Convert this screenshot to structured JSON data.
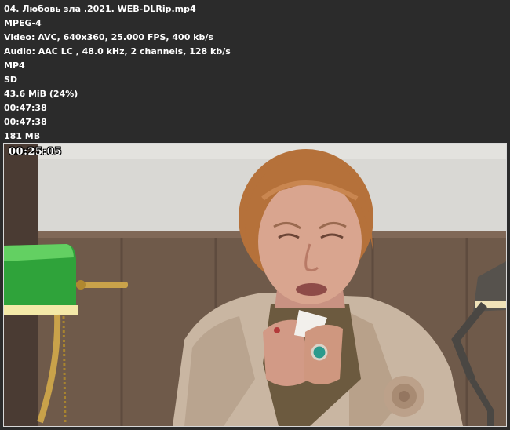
{
  "media_info": {
    "lines": [
      "04. Любовь зла .2021. WEB-DLRip.mp4",
      "MPEG-4",
      "Video: AVC, 640x360, 25.000 FPS, 400 kb/s",
      "Audio: AAC LC , 48.0 kHz, 2 channels, 128 kb/s",
      "MP4",
      "SD",
      "43.6 MiB (24%)",
      "00:47:38",
      "00:47:38",
      "181 MB"
    ]
  },
  "thumbnail": {
    "timestamp": "00:25:05",
    "colors": {
      "wall_upper": "#d9d8d4",
      "wall_panel": "#6f5a4a",
      "lamp_shade": "#2fa33a",
      "lamp_brass": "#c9a24a",
      "hair": "#b5713a",
      "skin": "#d9a58f",
      "jacket": "#c9b6a2"
    }
  }
}
